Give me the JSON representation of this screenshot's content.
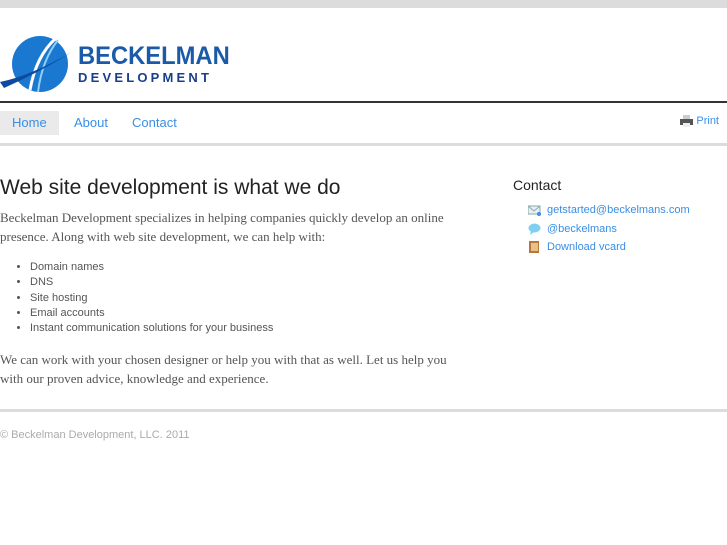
{
  "brand": {
    "name_line1": "BECKELMAN",
    "name_line2": "DEVELOPMENT"
  },
  "nav": {
    "items": [
      {
        "label": "Home"
      },
      {
        "label": "About"
      },
      {
        "label": "Contact"
      }
    ],
    "print": "Print"
  },
  "main": {
    "title": "Web site development is what we do",
    "intro": "Beckelman Development specializes in helping companies quickly develop an online presence. Along with web site development, we can help with:",
    "services": [
      "Domain names",
      "DNS",
      "Site hosting",
      "Email accounts",
      "Instant communication solutions for your business"
    ],
    "outro": "We can work with your chosen designer or help you with that as well. Let us help you with our proven advice, knowledge and experience."
  },
  "sidebar": {
    "title": "Contact",
    "items": [
      {
        "label": "getstarted@beckelmans.com",
        "icon": "email-icon"
      },
      {
        "label": "@beckelmans",
        "icon": "chat-icon"
      },
      {
        "label": "Download vcard",
        "icon": "vcard-icon"
      }
    ]
  },
  "footer": {
    "copyright": "© Beckelman Development, LLC. 2011"
  }
}
